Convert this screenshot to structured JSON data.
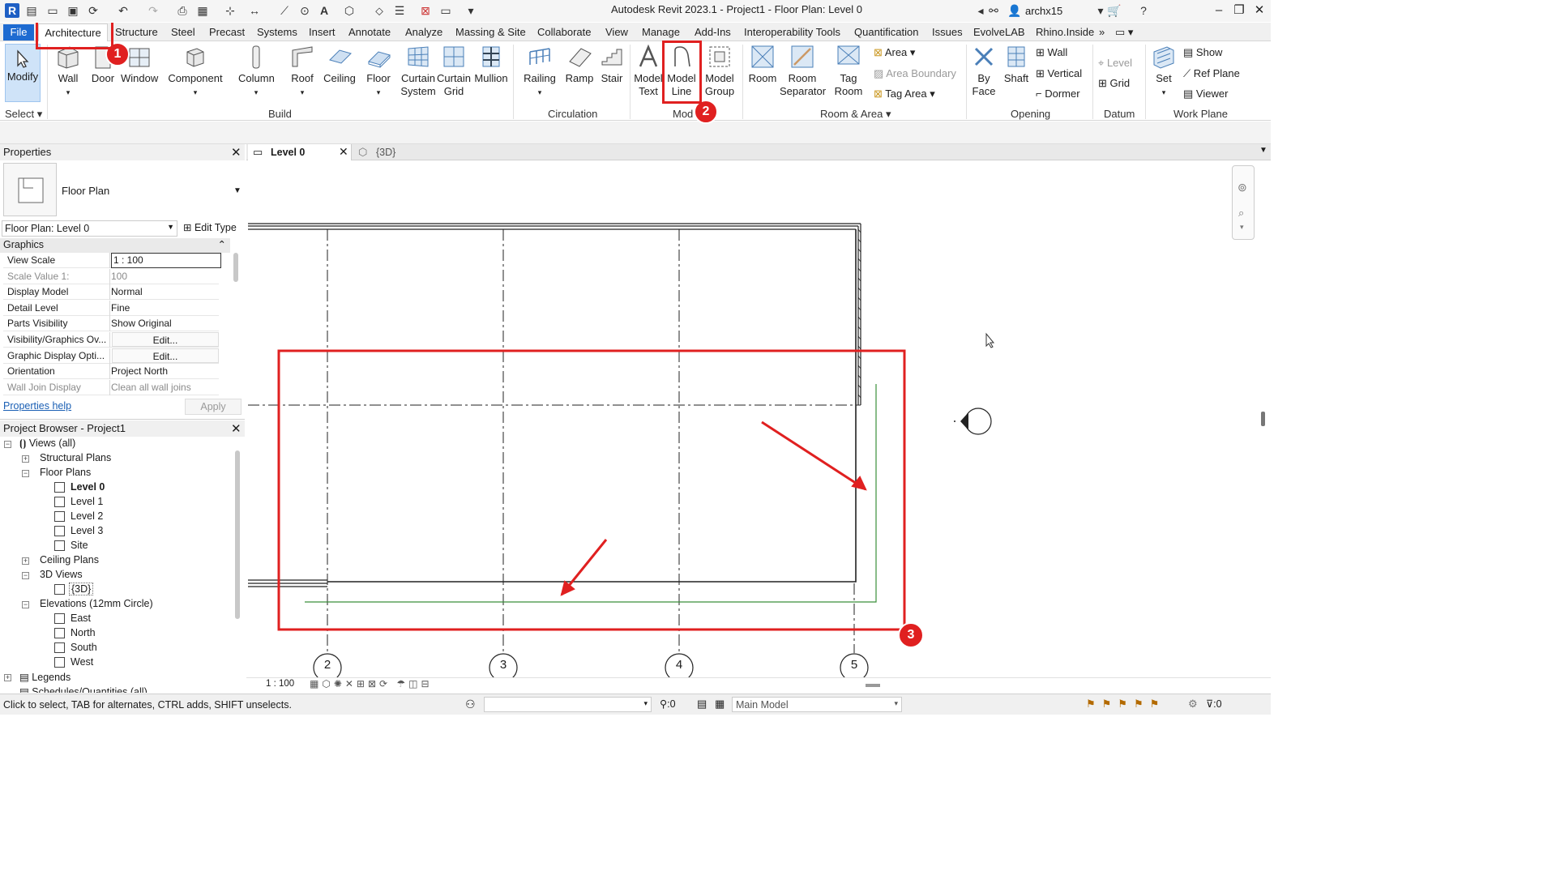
{
  "window": {
    "app_title": "Autodesk Revit 2023.1 - Project1 - Floor Plan: Level 0",
    "user_name": "archx15"
  },
  "tabs": [
    "File",
    "Architecture",
    "Structure",
    "Steel",
    "Precast",
    "Systems",
    "Insert",
    "Annotate",
    "Analyze",
    "Massing & Site",
    "Collaborate",
    "View",
    "Manage",
    "Add-Ins",
    "Interoperability Tools",
    "Quantification",
    "Issues",
    "EvolveLAB",
    "Rhino.Inside"
  ],
  "ribbon": {
    "select": {
      "modify": "Modify",
      "select": "Select"
    },
    "build": {
      "wall": "Wall",
      "door": "Door",
      "window": "Window",
      "component": "Component",
      "column": "Column",
      "roof": "Roof",
      "ceiling": "Ceiling",
      "floor": "Floor",
      "curtain_system_1": "Curtain",
      "curtain_system_2": "System",
      "curtain_grid_1": "Curtain",
      "curtain_grid_2": "Grid",
      "mullion": "Mullion",
      "panel": "Build"
    },
    "circulation": {
      "railing": "Railing",
      "ramp": "Ramp",
      "stair": "Stair",
      "panel": "Circulation"
    },
    "model": {
      "text_1": "Model",
      "text_2": "Text",
      "line_1": "Model",
      "line_2": "Line",
      "group_1": "Model",
      "group_2": "Group",
      "panel": "Mod"
    },
    "room_area": {
      "room": "Room",
      "sep_1": "Room",
      "sep_2": "Separator",
      "tag_1": "Tag",
      "tag_2": "Room",
      "area": "Area",
      "area_boundary": "Area  Boundary",
      "tag_area": "Tag  Area",
      "panel": "Room & Area"
    },
    "opening": {
      "by_face_1": "By",
      "by_face_2": "Face",
      "shaft": "Shaft",
      "wall": "Wall",
      "vertical": "Vertical",
      "dormer": "Dormer",
      "panel": "Opening"
    },
    "datum": {
      "level": "Level",
      "grid": "Grid",
      "panel": "Datum"
    },
    "work_plane": {
      "set": "Set",
      "show": "Show",
      "ref_plane": "Ref  Plane",
      "viewer": "Viewer",
      "panel": "Work Plane"
    }
  },
  "properties": {
    "title": "Properties",
    "type_name": "Floor Plan",
    "instance": "Floor Plan: Level 0",
    "edit_type": "Edit Type",
    "section": "Graphics",
    "rows": [
      {
        "k": "View Scale",
        "v": "1 : 100"
      },
      {
        "k": "Scale Value    1:",
        "v": "100"
      },
      {
        "k": "Display Model",
        "v": "Normal"
      },
      {
        "k": "Detail Level",
        "v": "Fine"
      },
      {
        "k": "Parts Visibility",
        "v": "Show Original"
      },
      {
        "k": "Visibility/Graphics Ov...",
        "v": "Edit..."
      },
      {
        "k": "Graphic Display Opti...",
        "v": "Edit..."
      },
      {
        "k": "Orientation",
        "v": "Project North"
      },
      {
        "k": "Wall Join Display",
        "v": "Clean all wall joins"
      }
    ],
    "help": "Properties help",
    "apply": "Apply"
  },
  "browser": {
    "title": "Project Browser - Project1",
    "views_all": "Views (all)",
    "structural_plans": "Structural Plans",
    "floor_plans": "Floor Plans",
    "floor_items": [
      "Level 0",
      "Level 1",
      "Level 2",
      "Level 3",
      "Site"
    ],
    "ceiling_plans": "Ceiling Plans",
    "views_3d": "3D Views",
    "view_3d_item": "{3D}",
    "elevations": "Elevations (12mm Circle)",
    "elev_items": [
      "East",
      "North",
      "South",
      "West"
    ],
    "legends": "Legends",
    "schedules": "Schedules/Quantities (all)"
  },
  "view_tabs": {
    "active": "Level 0",
    "other": "{3D}"
  },
  "canvas": {
    "grid_labels": [
      "2",
      "3",
      "4",
      "5"
    ],
    "scale": "1 : 100",
    "annotation_numbers": [
      "1",
      "2",
      "3"
    ],
    "annotation_color": "#e02020"
  },
  "status": {
    "hint": "Click to select, TAB for alternates, CTRL adds, SHIFT unselects.",
    "count": ":0",
    "workset": "Main Model",
    "filter_count": ":0"
  }
}
